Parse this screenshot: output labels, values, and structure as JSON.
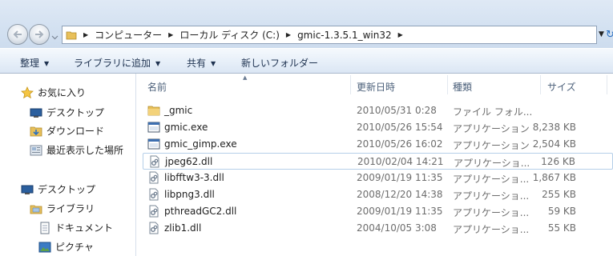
{
  "address": {
    "breadcrumbs": [
      "コンピューター",
      "ローカル ディスク (C:)",
      "gmic-1.3.5.1_win32"
    ]
  },
  "toolbar": {
    "organize": "整理",
    "library": "ライブラリに追加",
    "share": "共有",
    "new_folder": "新しいフォルダー"
  },
  "nav": {
    "favorites": "お気に入り",
    "desktop": "デスクトップ",
    "downloads": "ダウンロード",
    "recent": "最近表示した場所",
    "desktop2": "デスクトップ",
    "libraries": "ライブラリ",
    "documents": "ドキュメント",
    "pictures": "ピクチャ"
  },
  "columns": {
    "name": "名前",
    "date": "更新日時",
    "type": "種類",
    "size": "サイズ"
  },
  "files": [
    {
      "name": "_gmic",
      "date": "2010/05/31 0:28",
      "type": "ファイル フォル...",
      "size": "",
      "icon": "folder-icon"
    },
    {
      "name": "gmic.exe",
      "date": "2010/05/26 15:54",
      "type": "アプリケーション",
      "size": "8,238 KB",
      "icon": "exe-icon"
    },
    {
      "name": "gmic_gimp.exe",
      "date": "2010/05/26 16:02",
      "type": "アプリケーション",
      "size": "2,504 KB",
      "icon": "exe-icon"
    },
    {
      "name": "jpeg62.dll",
      "date": "2010/02/04 14:21",
      "type": "アプリケーショ...",
      "size": "126 KB",
      "icon": "dll-icon"
    },
    {
      "name": "libfftw3-3.dll",
      "date": "2009/01/19 11:35",
      "type": "アプリケーショ...",
      "size": "1,867 KB",
      "icon": "dll-icon"
    },
    {
      "name": "libpng3.dll",
      "date": "2008/12/20 14:38",
      "type": "アプリケーショ...",
      "size": "255 KB",
      "icon": "dll-icon"
    },
    {
      "name": "pthreadGC2.dll",
      "date": "2009/01/19 11:35",
      "type": "アプリケーショ...",
      "size": "59 KB",
      "icon": "dll-icon"
    },
    {
      "name": "zlib1.dll",
      "date": "2004/10/05 3:08",
      "type": "アプリケーショ...",
      "size": "55 KB",
      "icon": "dll-icon"
    }
  ]
}
